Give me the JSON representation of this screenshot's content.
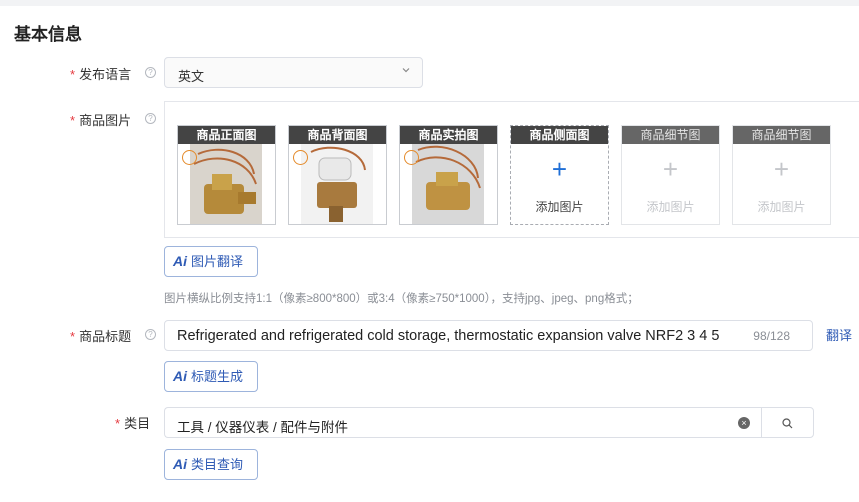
{
  "section": {
    "title": "基本信息"
  },
  "language": {
    "label": "发布语言",
    "value": "英文"
  },
  "images": {
    "label": "商品图片",
    "slots": [
      {
        "caption": "商品正面图"
      },
      {
        "caption": "商品背面图"
      },
      {
        "caption": "商品实拍图"
      },
      {
        "caption": "商品侧面图",
        "add": "添加图片"
      },
      {
        "caption": "商品细节图",
        "add": "添加图片"
      },
      {
        "caption": "商品细节图",
        "add": "添加图片"
      }
    ],
    "translate_button": "图片翻译",
    "hint": "图片横纵比例支持1:1（像素≥800*800）或3:4（像素≥750*1000），支持jpg、jpeg、png格式；"
  },
  "product_title": {
    "label": "商品标题",
    "value": "Refrigerated and refrigerated cold storage, thermostatic expansion valve NRF2 3 4 5",
    "counter": "98/128",
    "translate_link": "翻译",
    "generate_button": "标题生成"
  },
  "category": {
    "label": "类目",
    "value": "工具 / 仪器仪表 / 配件与附件",
    "query_button": "类目查询"
  },
  "colors": {
    "accent": "#2f5bb5",
    "required": "#e5393f",
    "plus": "#1f6fd6"
  },
  "ai_badge": "Ai"
}
